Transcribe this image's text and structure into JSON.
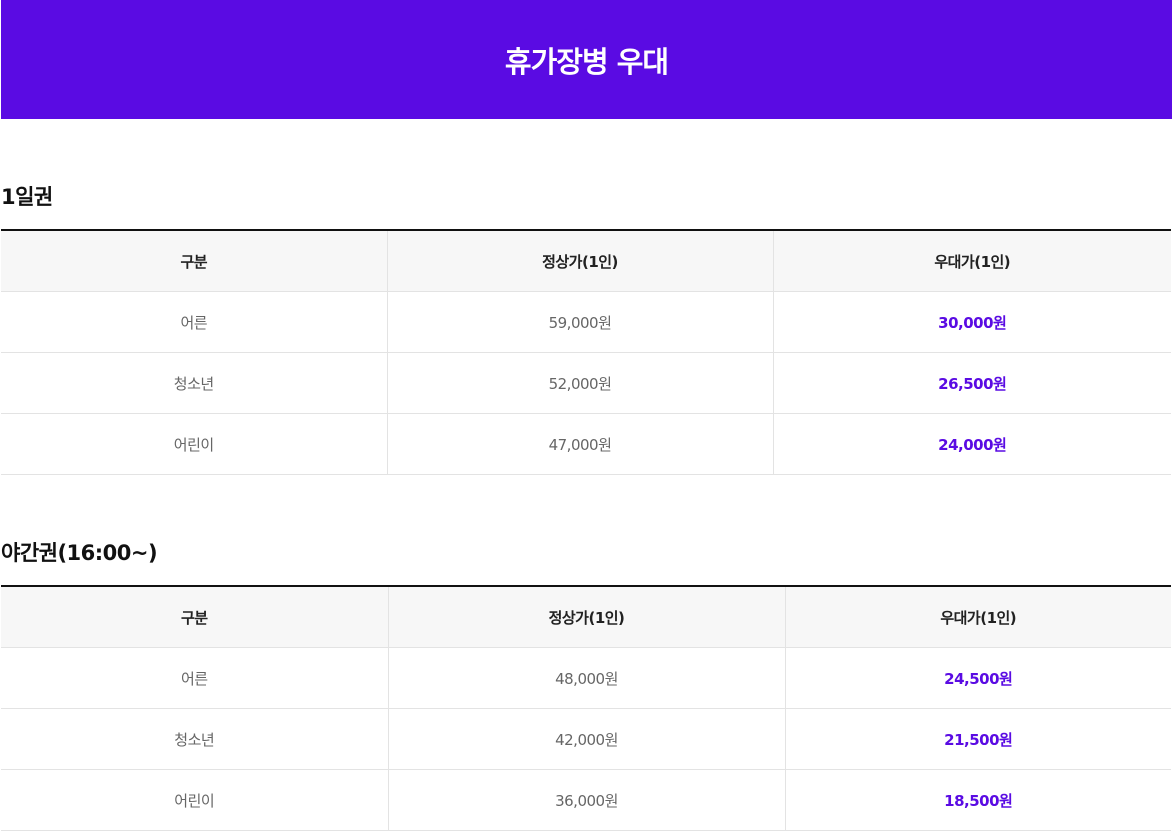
{
  "header": {
    "title": "휴가장병 우대"
  },
  "sections": [
    {
      "title": "1일권",
      "columns": [
        "구분",
        "정상가(1인)",
        "우대가(1인)"
      ],
      "rows": [
        {
          "category": "어른",
          "regular": "59,000원",
          "discount": "30,000원"
        },
        {
          "category": "청소년",
          "regular": "52,000원",
          "discount": "26,500원"
        },
        {
          "category": "어린이",
          "regular": "47,000원",
          "discount": "24,000원"
        }
      ]
    },
    {
      "title": "야간권(16:00~)",
      "columns": [
        "구분",
        "정상가(1인)",
        "우대가(1인)"
      ],
      "rows": [
        {
          "category": "어른",
          "regular": "48,000원",
          "discount": "24,500원"
        },
        {
          "category": "청소년",
          "regular": "42,000원",
          "discount": "21,500원"
        },
        {
          "category": "어린이",
          "regular": "36,000원",
          "discount": "18,500원"
        }
      ]
    }
  ],
  "colors": {
    "accent": "#5a0be3",
    "header_bg": "#5a0be3",
    "table_head_bg": "#f7f7f7",
    "border": "#e3e3e3"
  }
}
